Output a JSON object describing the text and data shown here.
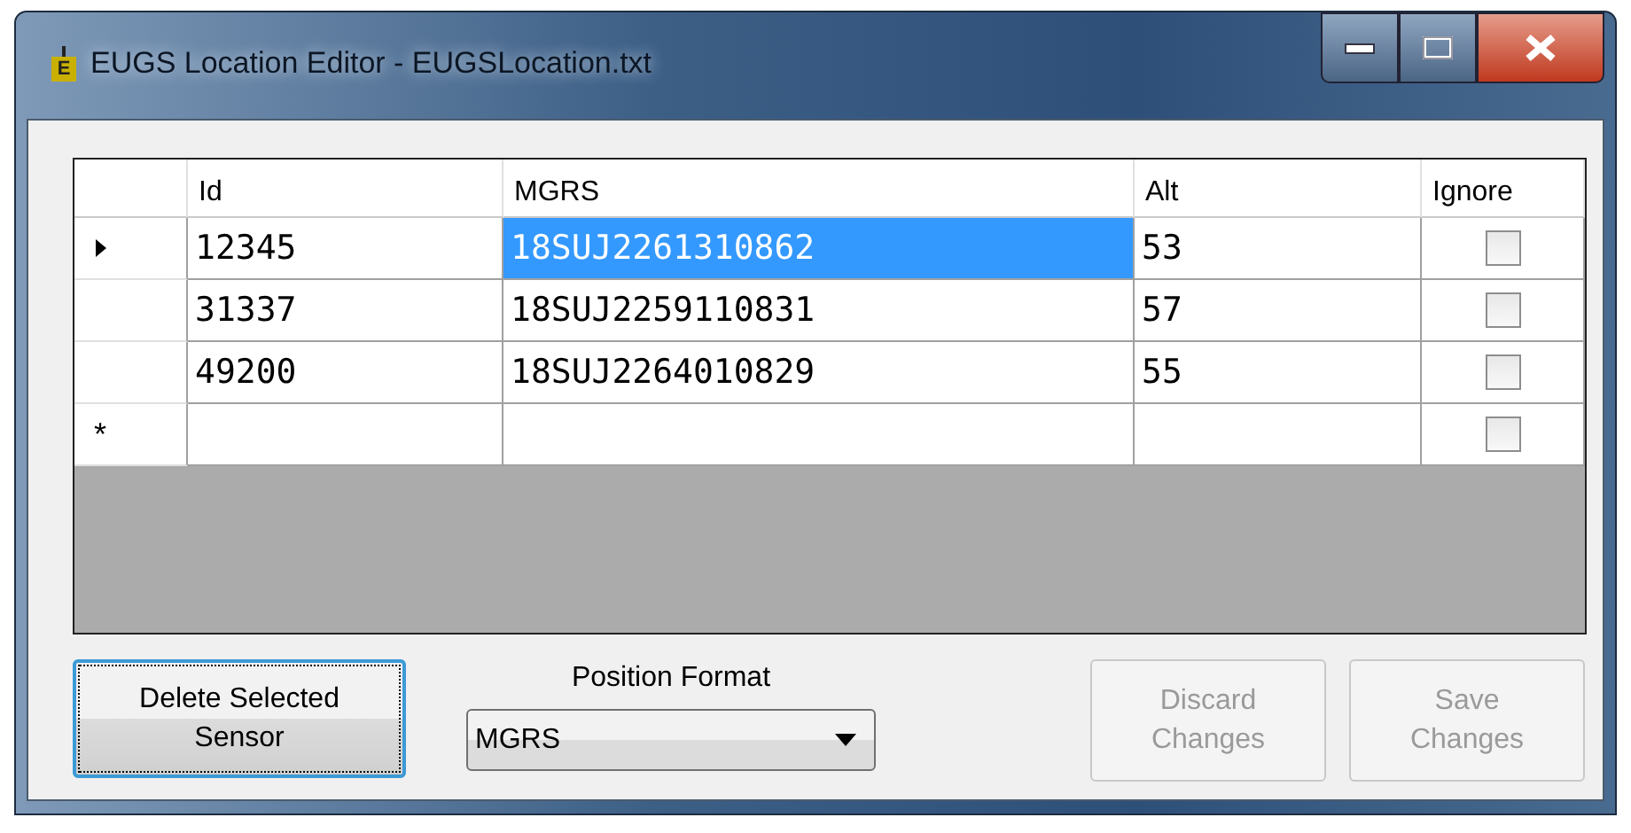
{
  "window": {
    "title": "EUGS Location Editor - EUGSLocation.txt",
    "app_icon_letter": "E"
  },
  "grid": {
    "columns": [
      "Id",
      "MGRS",
      "Alt",
      "Ignore"
    ],
    "rows": [
      {
        "kind": "data",
        "current": true,
        "cells": [
          {
            "text": "12345",
            "selected": false
          },
          {
            "text": "18SUJ2261310862",
            "selected": true
          },
          {
            "text": "53",
            "selected": false
          }
        ],
        "ignore": false
      },
      {
        "kind": "data",
        "current": false,
        "cells": [
          {
            "text": "31337",
            "selected": false
          },
          {
            "text": "18SUJ2259110831",
            "selected": false
          },
          {
            "text": "57",
            "selected": false
          }
        ],
        "ignore": false
      },
      {
        "kind": "data",
        "current": false,
        "cells": [
          {
            "text": "49200",
            "selected": false
          },
          {
            "text": "18SUJ2264010829",
            "selected": false
          },
          {
            "text": "55",
            "selected": false
          }
        ],
        "ignore": false
      },
      {
        "kind": "new",
        "marker": "*",
        "ignore": false
      }
    ]
  },
  "delete_button": {
    "label_lines": [
      "Delete Selected",
      "Sensor"
    ],
    "focused": true,
    "disabled": false
  },
  "position_format": {
    "label": "Position Format",
    "value": "MGRS"
  },
  "action_buttons": [
    {
      "label_lines": [
        "Discard",
        "Changes"
      ],
      "disabled": true
    },
    {
      "label_lines": [
        "Save",
        "Changes"
      ],
      "disabled": true
    }
  ]
}
